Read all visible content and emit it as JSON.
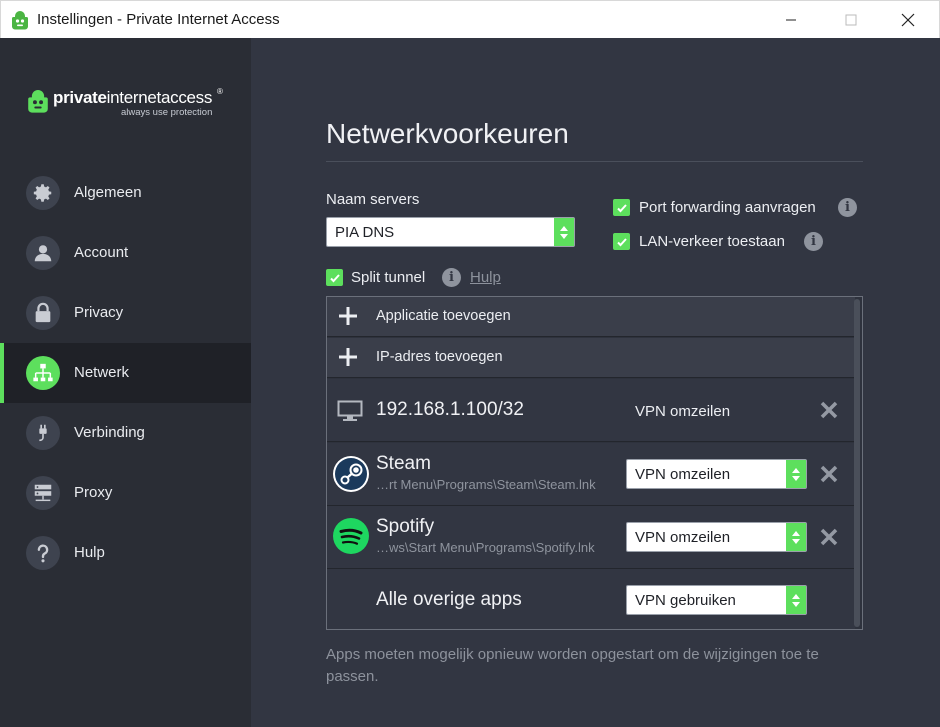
{
  "window": {
    "title": "Instellingen - Private Internet Access",
    "controls": [
      "minimize-icon",
      "maximize-icon",
      "close-icon"
    ]
  },
  "brand": {
    "name_bold": "private",
    "name_thin": "internetaccess",
    "registered": "®",
    "tagline": "always use protection"
  },
  "sidebar": {
    "items": [
      {
        "label": "Algemeen",
        "icon": "gear-icon",
        "active": false
      },
      {
        "label": "Account",
        "icon": "user-icon",
        "active": false
      },
      {
        "label": "Privacy",
        "icon": "lock-icon",
        "active": false
      },
      {
        "label": "Netwerk",
        "icon": "network-icon",
        "active": true
      },
      {
        "label": "Verbinding",
        "icon": "plug-icon",
        "active": false
      },
      {
        "label": "Proxy",
        "icon": "server-icon",
        "active": false
      },
      {
        "label": "Hulp",
        "icon": "question-icon",
        "active": false
      }
    ]
  },
  "main": {
    "title": "Netwerkvoorkeuren",
    "servers_label": "Naam servers",
    "dns_value": "PIA DNS",
    "port_forwarding_label": "Port forwarding aanvragen",
    "lan_label": "LAN-verkeer toestaan",
    "split_tunnel_label": "Split tunnel",
    "help_link": "Hulp",
    "info_glyph": "i",
    "add_app_label": "Applicatie toevoegen",
    "add_ip_label": "IP-adres toevoegen",
    "ip_entry": {
      "address": "192.168.1.100/32",
      "mode": "VPN omzeilen"
    },
    "apps": [
      {
        "name": "Steam",
        "path": "…rt Menu\\Programs\\Steam\\Steam.lnk",
        "mode": "VPN omzeilen",
        "icon": "steam-icon"
      },
      {
        "name": "Spotify",
        "path": "…ws\\Start Menu\\Programs\\Spotify.lnk",
        "mode": "VPN omzeilen",
        "icon": "spotify-icon"
      }
    ],
    "other_apps": {
      "name": "Alle overige apps",
      "mode": "VPN gebruiken"
    },
    "footer_note": "Apps moeten mogelijk opnieuw worden opgestart om de wijzigingen toe te passen."
  },
  "colors": {
    "accent": "#5ddf5d",
    "sidebar_bg": "#2a2d35",
    "main_bg": "#323642"
  }
}
